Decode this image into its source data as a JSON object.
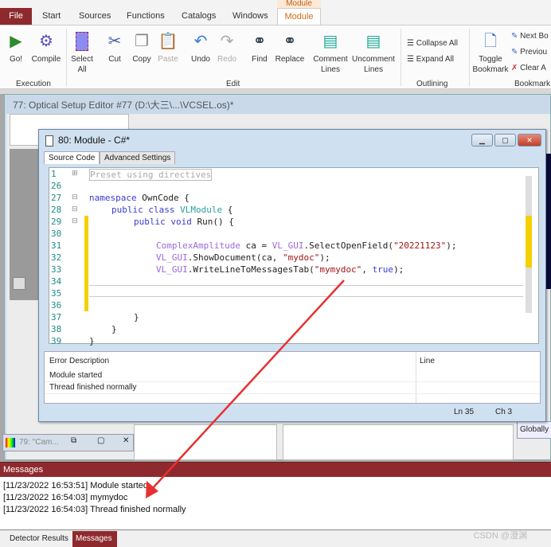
{
  "ribbon": {
    "context_label": "Module",
    "tabs": [
      "File",
      "Start",
      "Sources",
      "Functions",
      "Catalogs",
      "Windows",
      "Module"
    ],
    "buttons": {
      "go": "Go!",
      "compile": "Compile",
      "select_all": "Select All",
      "cut": "Cut",
      "copy": "Copy",
      "paste": "Paste",
      "undo": "Undo",
      "redo": "Redo",
      "find": "Find",
      "replace": "Replace",
      "comment": "Comment Lines",
      "uncomment": "Uncomment Lines",
      "collapse_all": "Collapse All",
      "expand_all": "Expand All",
      "toggle_bookmark": "Toggle Bookmark",
      "next_bookmark": "Next Bo",
      "previous_bookmark": "Previou",
      "clear_all": "Clear A"
    },
    "groups": {
      "execution": "Execution",
      "edit": "Edit",
      "outlining": "Outlining",
      "bookmark": "Bookmark"
    }
  },
  "window77": {
    "title": "77: Optical Setup Editor #77 (D:\\大三\\...\\VCSEL.os)*",
    "globally": "Globally"
  },
  "window79": {
    "title": "79: \"Cam..."
  },
  "dialog": {
    "title": "80: Module - C#*",
    "tabs": [
      "Source Code",
      "Advanced Settings"
    ],
    "code": {
      "line_numbers": [
        "1",
        "26",
        "27",
        "28",
        "29",
        "30",
        "31",
        "32",
        "33",
        "34",
        "35",
        "36",
        "37",
        "38",
        "39"
      ],
      "preset": "Preset using directives",
      "l27a": "namespace",
      "l27b": " OwnCode {",
      "l28a": "public class",
      "l28b": "VLModule",
      "l28c": " {",
      "l29a": "public void",
      "l29b": " Run() {",
      "l31a": "ComplexAmplitude",
      "l31b": " ca = ",
      "l31c": "VL_GUI",
      "l31d": ".SelectOpenField(",
      "l31e": "\"20221123\"",
      "l31f": ");",
      "l32a": "VL_GUI",
      "l32b": ".ShowDocument(ca, ",
      "l32c": "\"mydoc\"",
      "l32d": ");",
      "l33a": "VL_GUI",
      "l33b": ".WriteLineToMessagesTab(",
      "l33c": "\"mymydoc\"",
      "l33d": ", ",
      "l33e": "true",
      "l33f": ");",
      "l37": "}",
      "l38": "}",
      "l39": "}"
    },
    "errors": {
      "headers": [
        "Error Description",
        "Line"
      ],
      "rows": [
        "Module started",
        "Thread finished normally"
      ]
    },
    "status": {
      "ln": "Ln 35",
      "ch": "Ch 3"
    }
  },
  "messages": {
    "title": "Messages",
    "lines": [
      "[11/23/2022 16:53:51] Module started",
      "[11/23/2022 16:54:03] mymydoc",
      "[11/23/2022 16:54:03] Thread finished normally"
    ]
  },
  "bottom_tabs": [
    "Detector Results",
    "Messages"
  ],
  "watermark": "CSDN @澄渊",
  "colors": {
    "accent": "#8e2a2e",
    "module_tab": "#d06a1c",
    "annotation_arrow": "#e83030"
  }
}
